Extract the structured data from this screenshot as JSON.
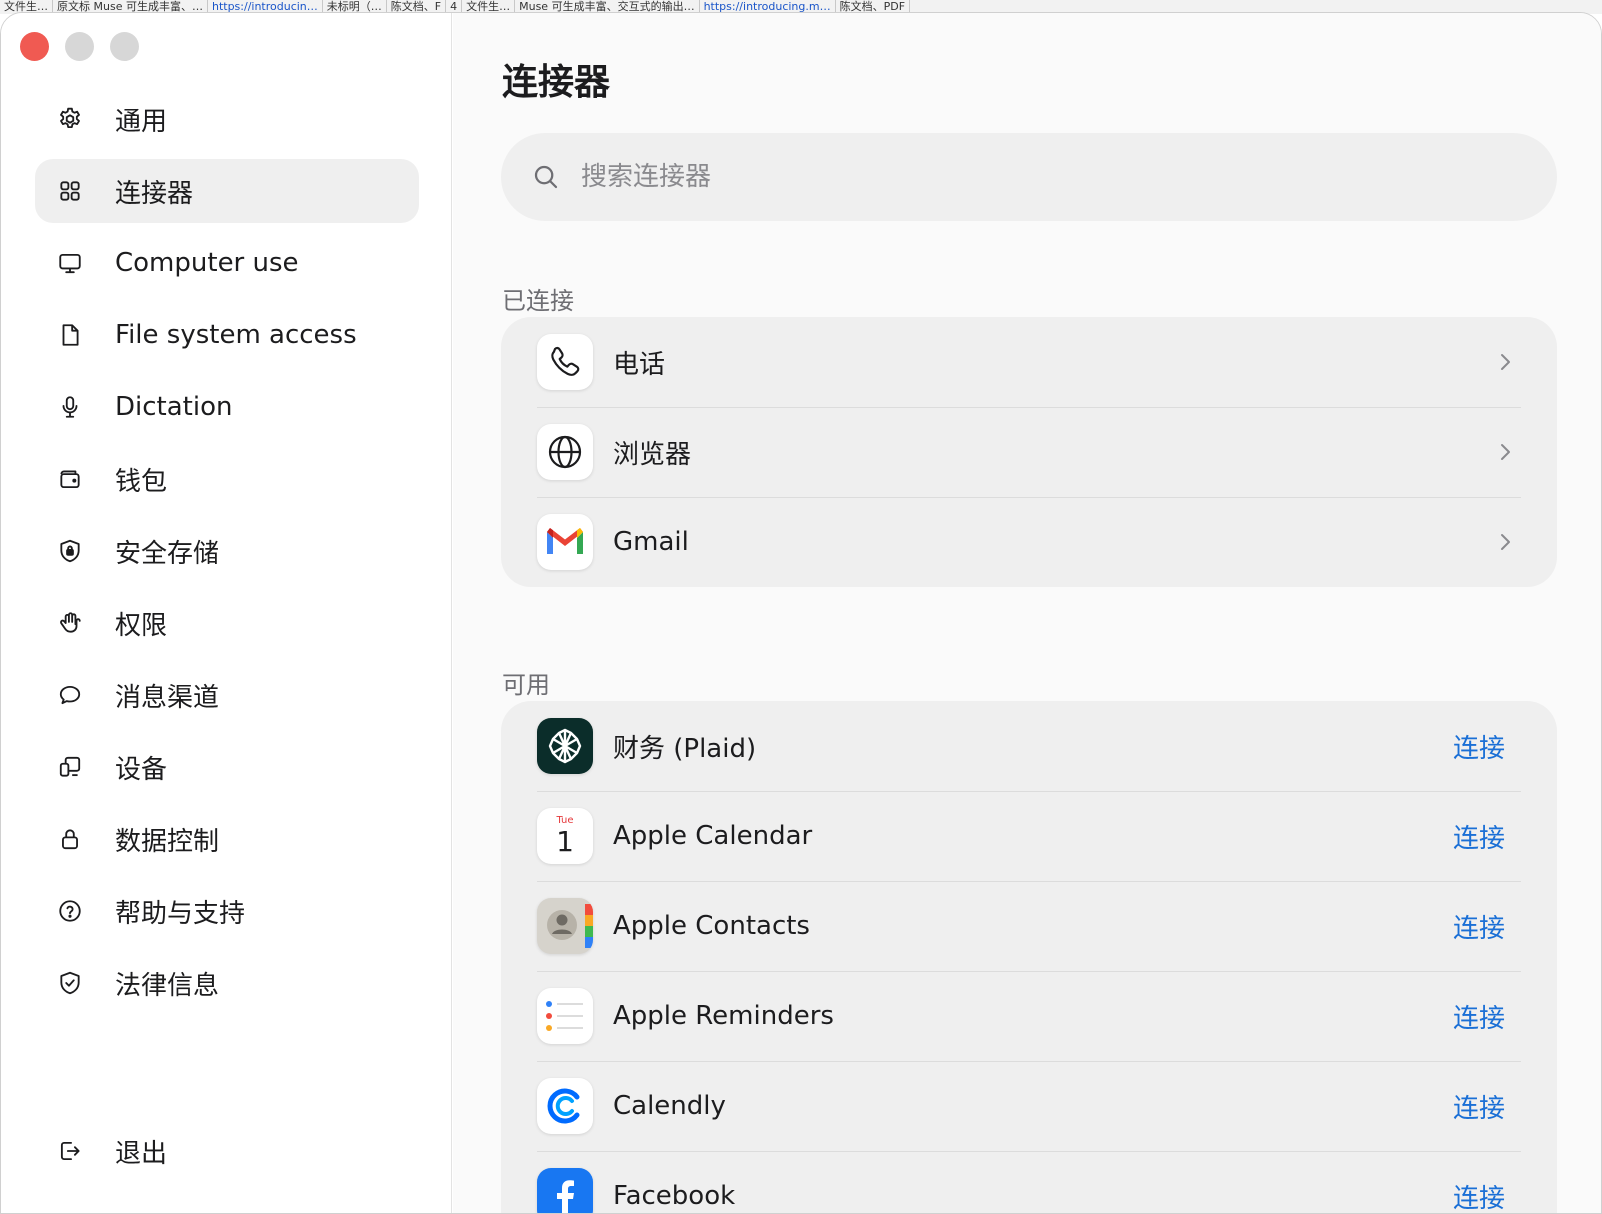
{
  "background_tabs": [
    {
      "label": "文件生…",
      "link": false
    },
    {
      "label": "原文标 Muse 可生成丰富、…",
      "link": false
    },
    {
      "label": "https://introducin…",
      "link": true
    },
    {
      "label": "未标明（…",
      "link": false
    },
    {
      "label": "陈文档、F",
      "link": false
    },
    {
      "label": "4",
      "link": false
    },
    {
      "label": "文件生…",
      "link": false
    },
    {
      "label": "Muse 可生成丰富、交互式的输出…",
      "link": false
    },
    {
      "label": "https://introducing.m…",
      "link": true
    },
    {
      "label": "陈文档、PDF",
      "link": false
    }
  ],
  "sidebar": {
    "items": [
      {
        "label": "通用",
        "icon": "gear-icon"
      },
      {
        "label": "连接器",
        "icon": "grid-icon"
      },
      {
        "label": "Computer use",
        "icon": "monitor-icon"
      },
      {
        "label": "File system access",
        "icon": "file-icon"
      },
      {
        "label": "Dictation",
        "icon": "microphone-icon"
      },
      {
        "label": "钱包",
        "icon": "wallet-icon"
      },
      {
        "label": "安全存储",
        "icon": "shield-lock-icon"
      },
      {
        "label": "权限",
        "icon": "hand-icon"
      },
      {
        "label": "消息渠道",
        "icon": "chat-bubble-icon"
      },
      {
        "label": "设备",
        "icon": "devices-icon"
      },
      {
        "label": "数据控制",
        "icon": "lock-icon"
      },
      {
        "label": "帮助与支持",
        "icon": "help-circle-icon"
      },
      {
        "label": "法律信息",
        "icon": "shield-check-icon"
      }
    ],
    "active_index": 1,
    "logout_label": "退出"
  },
  "main": {
    "title": "连接器",
    "search_placeholder": "搜索连接器",
    "connected_label": "已连接",
    "connected": [
      {
        "name": "电话",
        "icon": "phone-icon"
      },
      {
        "name": "浏览器",
        "icon": "globe-icon"
      },
      {
        "name": "Gmail",
        "icon": "gmail-icon"
      }
    ],
    "available_label": "可用",
    "available": [
      {
        "name": "财务 (Plaid)",
        "icon": "plaid-icon",
        "action": "连接"
      },
      {
        "name": "Apple Calendar",
        "icon": "calendar-icon",
        "action": "连接",
        "icon_day": "Tue",
        "icon_date": "1"
      },
      {
        "name": "Apple Contacts",
        "icon": "contacts-icon",
        "action": "连接"
      },
      {
        "name": "Apple Reminders",
        "icon": "reminders-icon",
        "action": "连接"
      },
      {
        "name": "Calendly",
        "icon": "calendly-icon",
        "action": "连接"
      },
      {
        "name": "Facebook",
        "icon": "facebook-icon",
        "action": "连接"
      }
    ]
  },
  "colors": {
    "accent_link": "#1a6fd6",
    "close_button": "#f05a52",
    "active_nav_bg": "#efefef"
  }
}
